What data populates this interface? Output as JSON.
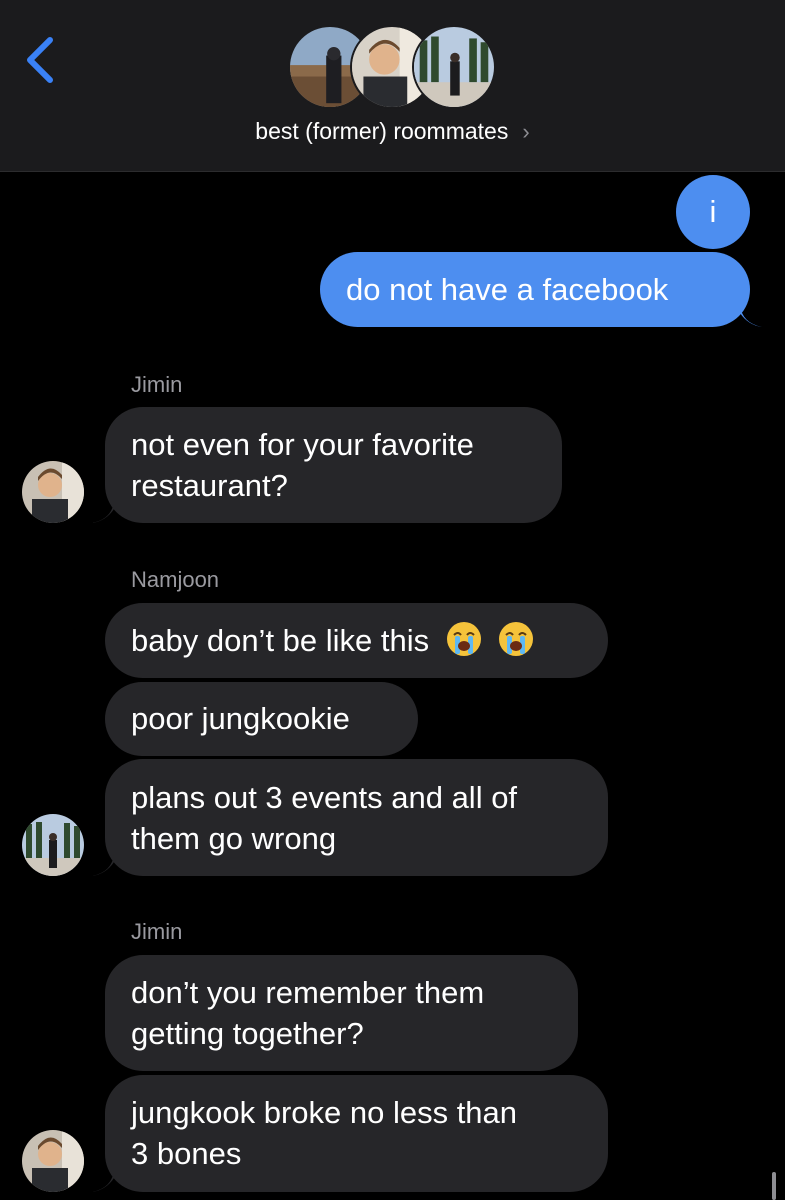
{
  "header": {
    "title": "best (former) roommates",
    "chevron": "›",
    "back_icon": "chevron-left-icon"
  },
  "messages": [
    {
      "id": "m1",
      "direction": "out",
      "text": "i"
    },
    {
      "id": "m2",
      "direction": "out",
      "text": "do not have a facebook"
    },
    {
      "id": "m3",
      "direction": "in",
      "sender": "Jimin",
      "lines": [
        "not even for your favorite",
        "restaurant?"
      ]
    },
    {
      "id": "m4",
      "direction": "in",
      "sender": "Namjoon",
      "text": "baby don’t be like this",
      "emoji": [
        "loudly-crying-face",
        "loudly-crying-face"
      ]
    },
    {
      "id": "m5",
      "direction": "in",
      "text": "poor jungkookie"
    },
    {
      "id": "m6",
      "direction": "in",
      "lines": [
        "plans out 3 events and all of",
        "them go wrong"
      ]
    },
    {
      "id": "m7",
      "direction": "in",
      "sender": "Jimin",
      "lines": [
        "don’t you remember them",
        "getting together?"
      ]
    },
    {
      "id": "m8",
      "direction": "in",
      "lines": [
        "jungkook broke no less than",
        "3 bones"
      ]
    }
  ],
  "colors": {
    "outgoing": "#4d8ef0",
    "incoming": "#262629",
    "header_bg": "#1b1b1d",
    "accent": "#3a82f7"
  }
}
